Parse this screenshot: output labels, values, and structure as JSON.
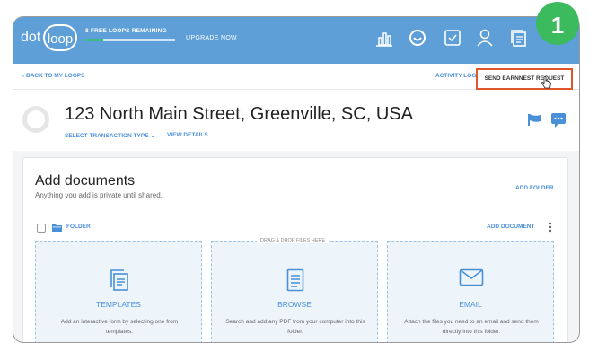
{
  "logo": {
    "dot": "dot",
    "loop": "loop"
  },
  "topbar": {
    "free_loops": "8 FREE LOOPS REMAINING",
    "free_loops_progress": 0.2,
    "upgrade": "UPGRADE NOW",
    "icons": [
      "chart-icon",
      "smiley-icon",
      "checkbox-icon",
      "user-icon",
      "documents-icon"
    ]
  },
  "callout_badge": "1",
  "subbar": {
    "back": "‹ BACK TO MY LOOPS",
    "activity_log": "ACTIVITY LOG",
    "send_earnest": "SEND EARNNEST REQUEST"
  },
  "header": {
    "title": "123 North Main Street, Greenville, SC, USA",
    "transaction_type": "SELECT TRANSACTION TYPE ⌄",
    "view_details": "VIEW DETAILS"
  },
  "documents": {
    "title": "Add documents",
    "subtitle": "Anything you add is private until shared.",
    "add_folder": "ADD FOLDER",
    "folder_label": "FOLDER",
    "add_document": "ADD DOCUMENT",
    "drag_drop": "DRAG & DROP FILES HERE",
    "panels": [
      {
        "label": "TEMPLATES",
        "desc": "Add an interactive form by selecting one from templates."
      },
      {
        "label": "BROWSE",
        "desc": "Search and add any PDF from your computer into this folder."
      },
      {
        "label": "EMAIL",
        "desc": "Attach the files you need to an email and send them directly into this folder."
      }
    ]
  },
  "colors": {
    "topbar": "#5e9fd8",
    "accent": "#4a90d9",
    "highlight": "#e0562b",
    "badge": "#3cbb5e"
  }
}
